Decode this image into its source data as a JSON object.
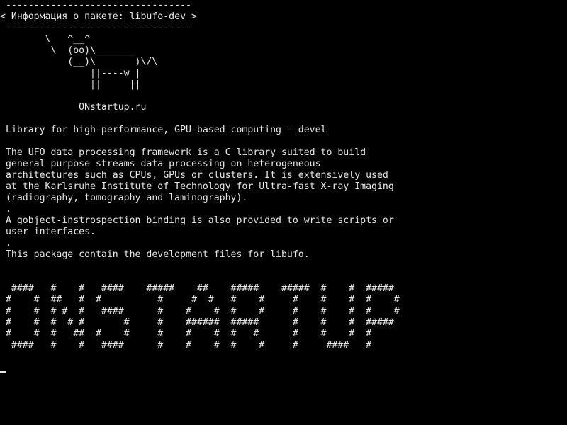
{
  "terminal": {
    "background": "#000000",
    "foreground": "#e8e8e8",
    "cowsay_banner": {
      "top_border": " ---------------------------------",
      "title": "< Информация о пакете: libufo-dev >",
      "bottom_border": " ---------------------------------",
      "cow": [
        "        \\   ^__^",
        "         \\  (oo)\\_______",
        "            (__)\\       )\\/\\",
        "                ||----w |",
        "                ||     ||"
      ],
      "site": "              ONstartup.ru"
    },
    "package_info": {
      "summary": " Library for high-performance, GPU-based computing - devel",
      "description_lines": [
        " The UFO data processing framework is a C library suited to build",
        " general purpose streams data processing on heterogeneous",
        " architectures such as CPUs, GPUs or clusters. It is extensively used",
        " at the Karlsruhe Institute of Technology for Ultra-fast X-ray Imaging",
        " (radiography, tomography and laminography).",
        " .",
        " A gobject-instrospection binding is also provided to write scripts or",
        " user interfaces.",
        " .",
        " This package contain the development files for libufo."
      ]
    },
    "ascii_art": [
      "  ####   #    #   ####    #####    ##    #####    #####  #    #  #####",
      " #    #  ##   #  #          #     #  #   #    #     #    #    #  #    #",
      " #    #  # #  #   ####      #    #    #  #    #     #    #    #  #    #",
      " #    #  #  # #       #     #    ######  #####      #    #    #  #####",
      " #    #  #   ##  #    #     #    #    #  #   #      #    #    #  #",
      "  ####   #    #   ####      #    #    #  #    #     #     ####   #"
    ]
  }
}
